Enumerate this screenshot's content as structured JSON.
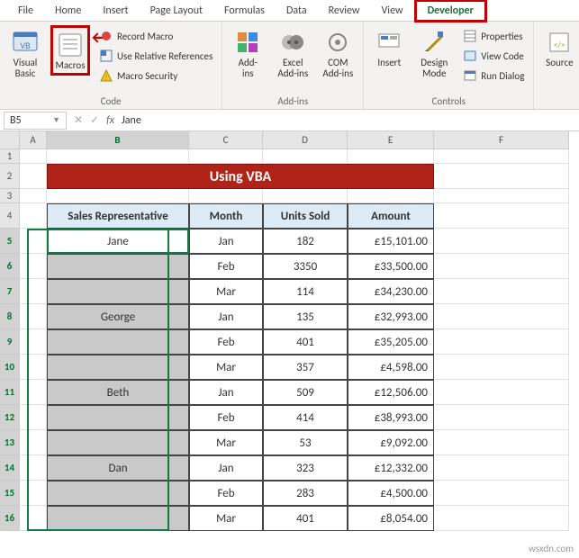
{
  "tabs": [
    "File",
    "Home",
    "Insert",
    "Page Layout",
    "Formulas",
    "Data",
    "Review",
    "View",
    "Developer"
  ],
  "activeTab": "Developer",
  "ribbon": {
    "code": {
      "vb": "Visual\nBasic",
      "macros": "Macros",
      "record": "Record Macro",
      "relref": "Use Relative References",
      "security": "Macro Security",
      "group": "Code"
    },
    "addins": {
      "addins": "Add-\nins",
      "excel": "Excel\nAdd-ins",
      "com": "COM\nAdd-ins",
      "group": "Add-ins"
    },
    "controls": {
      "insert": "Insert",
      "design": "Design\nMode",
      "props": "Properties",
      "viewcode": "View Code",
      "rundialog": "Run Dialog",
      "group": "Controls"
    },
    "xml": {
      "source": "Source"
    }
  },
  "namebox": "B5",
  "fxlabel": "fx",
  "fxvalue": "Jane",
  "columns": [
    "A",
    "B",
    "C",
    "D",
    "E",
    "F"
  ],
  "rowNums": [
    "1",
    "2",
    "3",
    "4",
    "5",
    "6",
    "7",
    "8",
    "9",
    "10",
    "11",
    "12",
    "13",
    "14",
    "15",
    "16"
  ],
  "titleText": "Using VBA",
  "headers": {
    "b": "Sales Representative",
    "c": "Month",
    "d": "Units Sold",
    "e": "Amount"
  },
  "rows": [
    {
      "b": "Jane",
      "c": "Jan",
      "d": "182",
      "e": "£15,101.00"
    },
    {
      "b": "",
      "c": "Feb",
      "d": "3350",
      "e": "£33,500.00"
    },
    {
      "b": "",
      "c": "Mar",
      "d": "114",
      "e": "£34,230.00"
    },
    {
      "b": "George",
      "c": "Jan",
      "d": "135",
      "e": "£32,993.00"
    },
    {
      "b": "",
      "c": "Feb",
      "d": "401",
      "e": "£35,205.00"
    },
    {
      "b": "",
      "c": "Mar",
      "d": "357",
      "e": "£4,598.00"
    },
    {
      "b": "Beth",
      "c": "Jan",
      "d": "509",
      "e": "£12,506.00"
    },
    {
      "b": "",
      "c": "Feb",
      "d": "414",
      "e": "£38,993.00"
    },
    {
      "b": "",
      "c": "Mar",
      "d": "53",
      "e": "£9,092.00"
    },
    {
      "b": "Dan",
      "c": "Jan",
      "d": "323",
      "e": "£12,332.00"
    },
    {
      "b": "",
      "c": "Feb",
      "d": "283",
      "e": "£4,500.00"
    },
    {
      "b": "",
      "c": "Mar",
      "d": "401",
      "e": "£8,054.00"
    }
  ],
  "watermark": "wsxdn.com",
  "chart_data": {
    "type": "table",
    "title": "Using VBA",
    "columns": [
      "Sales Representative",
      "Month",
      "Units Sold",
      "Amount"
    ],
    "rows": [
      [
        "Jane",
        "Jan",
        182,
        15101.0
      ],
      [
        "Jane",
        "Feb",
        3350,
        33500.0
      ],
      [
        "Jane",
        "Mar",
        114,
        34230.0
      ],
      [
        "George",
        "Jan",
        135,
        32993.0
      ],
      [
        "George",
        "Feb",
        401,
        35205.0
      ],
      [
        "George",
        "Mar",
        357,
        4598.0
      ],
      [
        "Beth",
        "Jan",
        509,
        12506.0
      ],
      [
        "Beth",
        "Feb",
        414,
        38993.0
      ],
      [
        "Beth",
        "Mar",
        53,
        9092.0
      ],
      [
        "Dan",
        "Jan",
        323,
        12332.0
      ],
      [
        "Dan",
        "Feb",
        283,
        4500.0
      ],
      [
        "Dan",
        "Mar",
        401,
        8054.0
      ]
    ],
    "currency": "GBP"
  }
}
